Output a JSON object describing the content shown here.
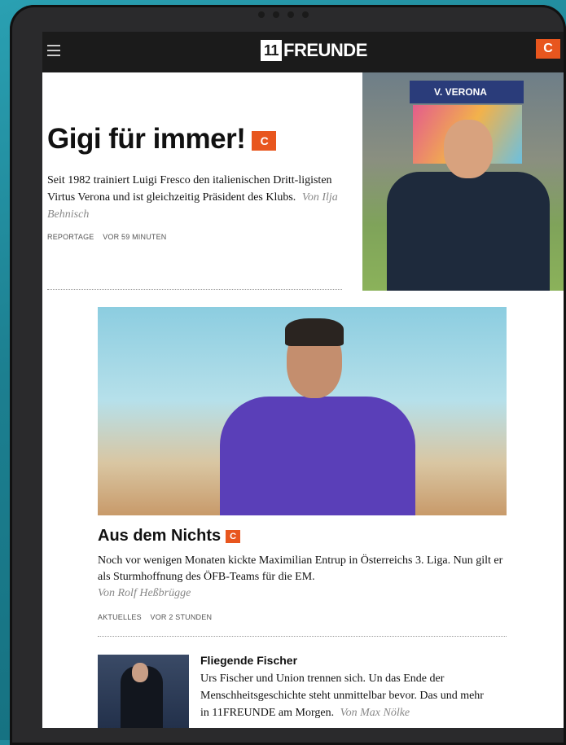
{
  "header": {
    "menu_icon": "hamburger-icon",
    "logo_number": "11",
    "logo_text": "FREUNDE",
    "plus_badge": "C"
  },
  "hero": {
    "title": "Gigi für immer!",
    "badge": "C",
    "description": "Seit 1982 trainiert Luigi Fresco den italienischen Dritt-ligisten Virtus Verona und ist gleichzeitig Präsident des Klubs.",
    "author": "Von Ilja Behnisch",
    "category": "REPORTAGE",
    "time": "VOR 59 MINUTEN",
    "photo_sign": "V. VERONA"
  },
  "article": {
    "title": "Aus dem Nichts",
    "badge": "C",
    "description": "Noch vor wenigen Monaten kickte Maximilian Entrup in Österreichs 3. Liga. Nun gilt er als Sturmhoffnung des ÖFB-Teams für die EM.",
    "author": "Von Rolf Heßbrügge",
    "category": "AKTUELLES",
    "time": "VOR 2 STUNDEN"
  },
  "small_article": {
    "title": "Fliegende Fischer",
    "description": "Urs Fischer und Union trennen sich. Un das Ende der Menschheitsgeschichte steht unmittelbar bevor. Das und mehr in 11FREUNDE am Morgen.",
    "author": "Von Max Nölke"
  },
  "colors": {
    "accent": "#e8561e",
    "topbar": "#1b1b1b",
    "background": "#1f8a9c"
  }
}
